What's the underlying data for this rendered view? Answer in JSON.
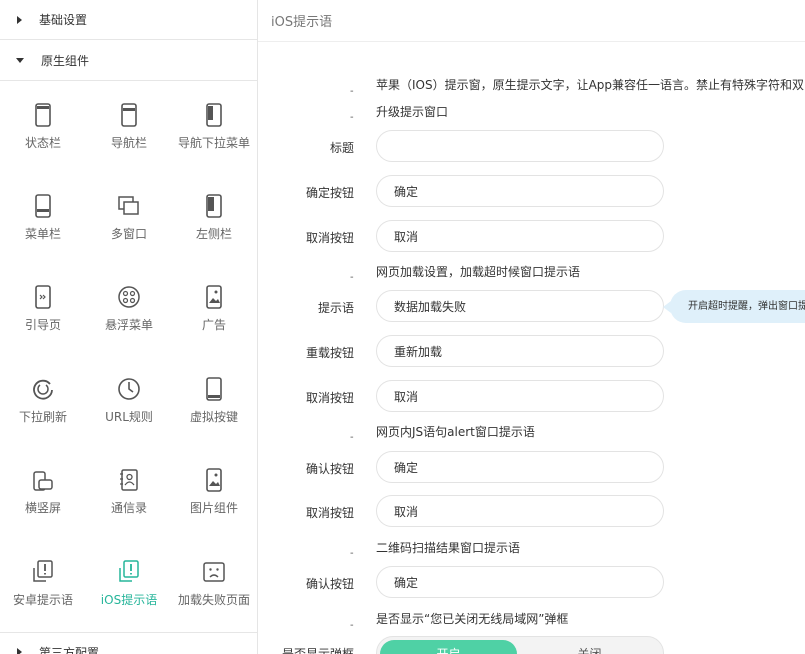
{
  "sidebar": {
    "top_category": "基础设置",
    "open_category": "原生组件",
    "bottom_category": "第三方配置",
    "items": [
      {
        "label": "状态栏",
        "icon": "phone-statusbar-icon"
      },
      {
        "label": "导航栏",
        "icon": "phone-navbar-icon"
      },
      {
        "label": "导航下拉菜单",
        "icon": "phone-dropdown-icon"
      },
      {
        "label": "菜单栏",
        "icon": "phone-menubar-icon"
      },
      {
        "label": "多窗口",
        "icon": "multi-window-icon"
      },
      {
        "label": "左侧栏",
        "icon": "phone-sidebar-icon"
      },
      {
        "label": "引导页",
        "icon": "guide-page-icon"
      },
      {
        "label": "悬浮菜单",
        "icon": "floating-menu-icon"
      },
      {
        "label": "广告",
        "icon": "ad-image-icon"
      },
      {
        "label": "下拉刷新",
        "icon": "refresh-icon"
      },
      {
        "label": "URL规则",
        "icon": "clock-icon"
      },
      {
        "label": "虚拟按键",
        "icon": "virtual-key-icon"
      },
      {
        "label": "横竖屏",
        "icon": "rotate-screen-icon"
      },
      {
        "label": "通信录",
        "icon": "contacts-icon"
      },
      {
        "label": "图片组件",
        "icon": "image-icon"
      },
      {
        "label": "安卓提示语",
        "icon": "android-alert-icon"
      },
      {
        "label": "iOS提示语",
        "icon": "ios-alert-icon",
        "active": true
      },
      {
        "label": "加载失败页面",
        "icon": "sad-face-icon"
      }
    ],
    "active_color": "#26b59a"
  },
  "main": {
    "title": "iOS提示语",
    "dash": "-",
    "intro": "苹果（IOS）提示窗，原生提示文字，让App兼容任一语言。禁止有特殊字符和双引号",
    "sections": {
      "upgrade": "升级提示窗口",
      "web_loading": "网页加载设置，加载超时候窗口提示语",
      "js_alert": "网页内JS语句alert窗口提示语",
      "qr": "二维码扫描结果窗口提示语",
      "lan": "是否显示“您已关闭无线局域网”弹框"
    },
    "fields": {
      "title_label": "标题",
      "title_value": "",
      "confirm_label": "确定按钮",
      "confirm_value": "确定",
      "cancel_label": "取消按钮",
      "cancel_value": "取消",
      "prompt_label": "提示语",
      "prompt_value": "数据加载失败",
      "reload_label": "重载按钮",
      "reload_value": "重新加载",
      "cancel2_label": "取消按钮",
      "cancel2_value": "取消",
      "js_confirm_label": "确认按钮",
      "js_confirm_value": "确定",
      "js_cancel_label": "取消按钮",
      "js_cancel_value": "取消",
      "qr_confirm_label": "确认按钮",
      "qr_confirm_value": "确定",
      "show_label": "是否显示弹框",
      "toggle_on": "开启",
      "toggle_off": "关闭"
    },
    "tooltip": "开启超时提醒，弹出窗口提示"
  }
}
